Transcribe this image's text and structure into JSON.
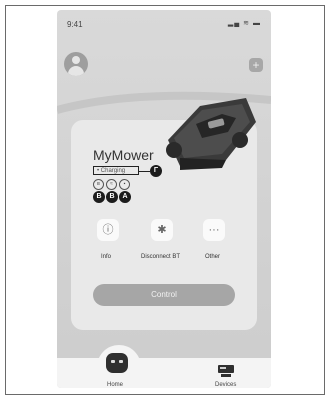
{
  "status_bar": {
    "time": "9:41",
    "icons": "signal-wifi-battery"
  },
  "header": {
    "avatar_icon": "user-avatar-icon",
    "add_icon": "plus-icon"
  },
  "device": {
    "name": "MyMower",
    "status": "• Charging",
    "callouts": {
      "status": "Γ",
      "a": "A",
      "b": "B",
      "b2": "B"
    },
    "indicators": [
      "bluetooth-indicator-icon",
      "wifi-indicator-icon",
      "cellular-indicator-icon"
    ]
  },
  "actions": [
    {
      "label": "Info",
      "icon": "info-icon"
    },
    {
      "label": "Disconnect BT",
      "icon": "bluetooth-icon"
    },
    {
      "label": "Other",
      "icon": "more-icon"
    }
  ],
  "control_button": {
    "label": "Control"
  },
  "bottom_nav": {
    "home": {
      "label": "Home",
      "icon": "robot-home-icon"
    },
    "devices": {
      "label": "Devices",
      "icon": "devices-icon"
    }
  }
}
